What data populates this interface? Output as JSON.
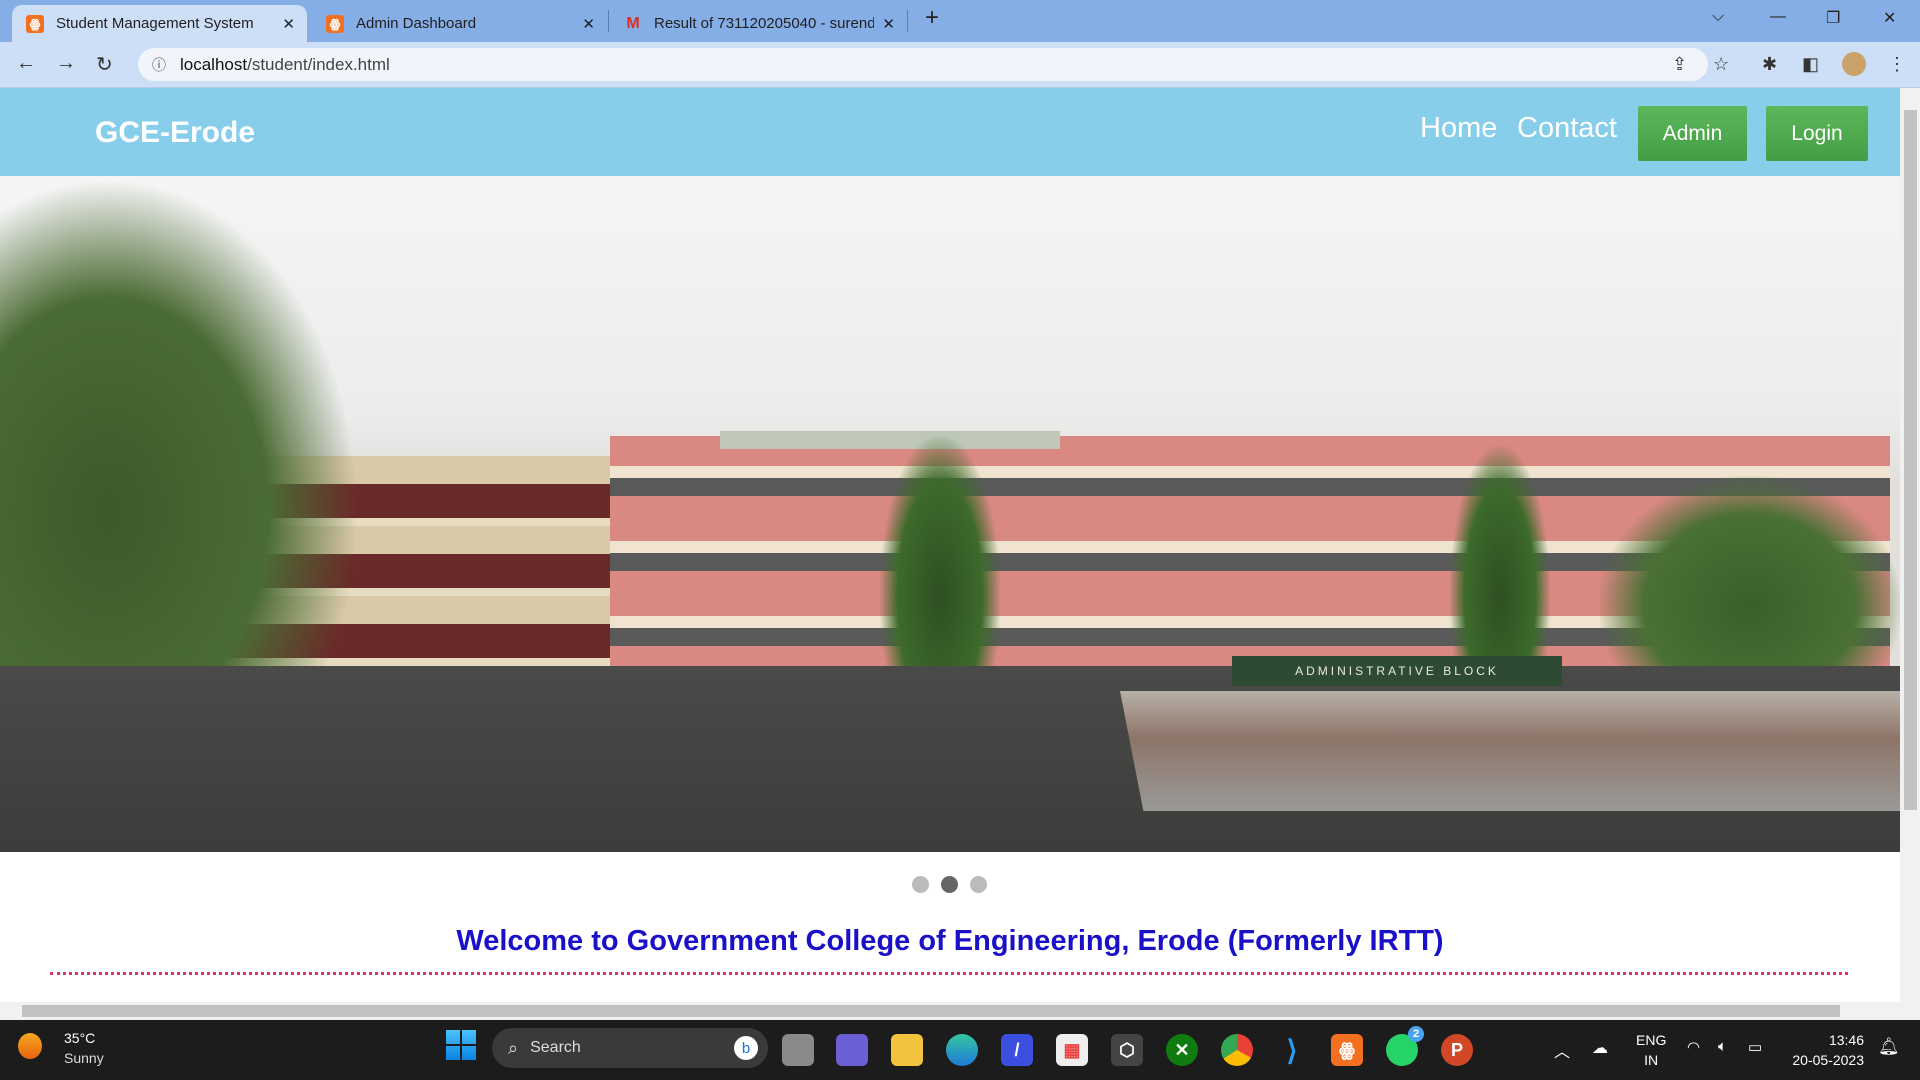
{
  "browser": {
    "tabs": [
      {
        "title": "Student Management System",
        "icon": "xampp-icon",
        "active": true
      },
      {
        "title": "Admin Dashboard",
        "icon": "xampp-icon",
        "active": false
      },
      {
        "title": "Result of 731120205040 - surend",
        "icon": "gmail-icon",
        "active": false
      }
    ],
    "url_host": "localhost",
    "url_path": "/student/index.html"
  },
  "page": {
    "brand": "GCE-Erode",
    "nav": {
      "home": "Home",
      "contact": "Contact",
      "admin": "Admin",
      "login": "Login"
    },
    "carousel": {
      "slides": 3,
      "active_index": 1,
      "building_sign": "ADMINISTRATIVE BLOCK"
    },
    "welcome": "Welcome to Government College of Engineering, Erode (Formerly IRTT)"
  },
  "taskbar": {
    "weather_temp": "35°C",
    "weather_desc": "Sunny",
    "search_placeholder": "Search",
    "lang": "ENG",
    "region": "IN",
    "time": "13:46",
    "date": "20-05-2023",
    "whatsapp_badge": "2"
  },
  "colors": {
    "navbar": "#87ceeb",
    "button": "#5cb85c",
    "welcome": "#1a10c8",
    "divider": "#e0306a"
  }
}
